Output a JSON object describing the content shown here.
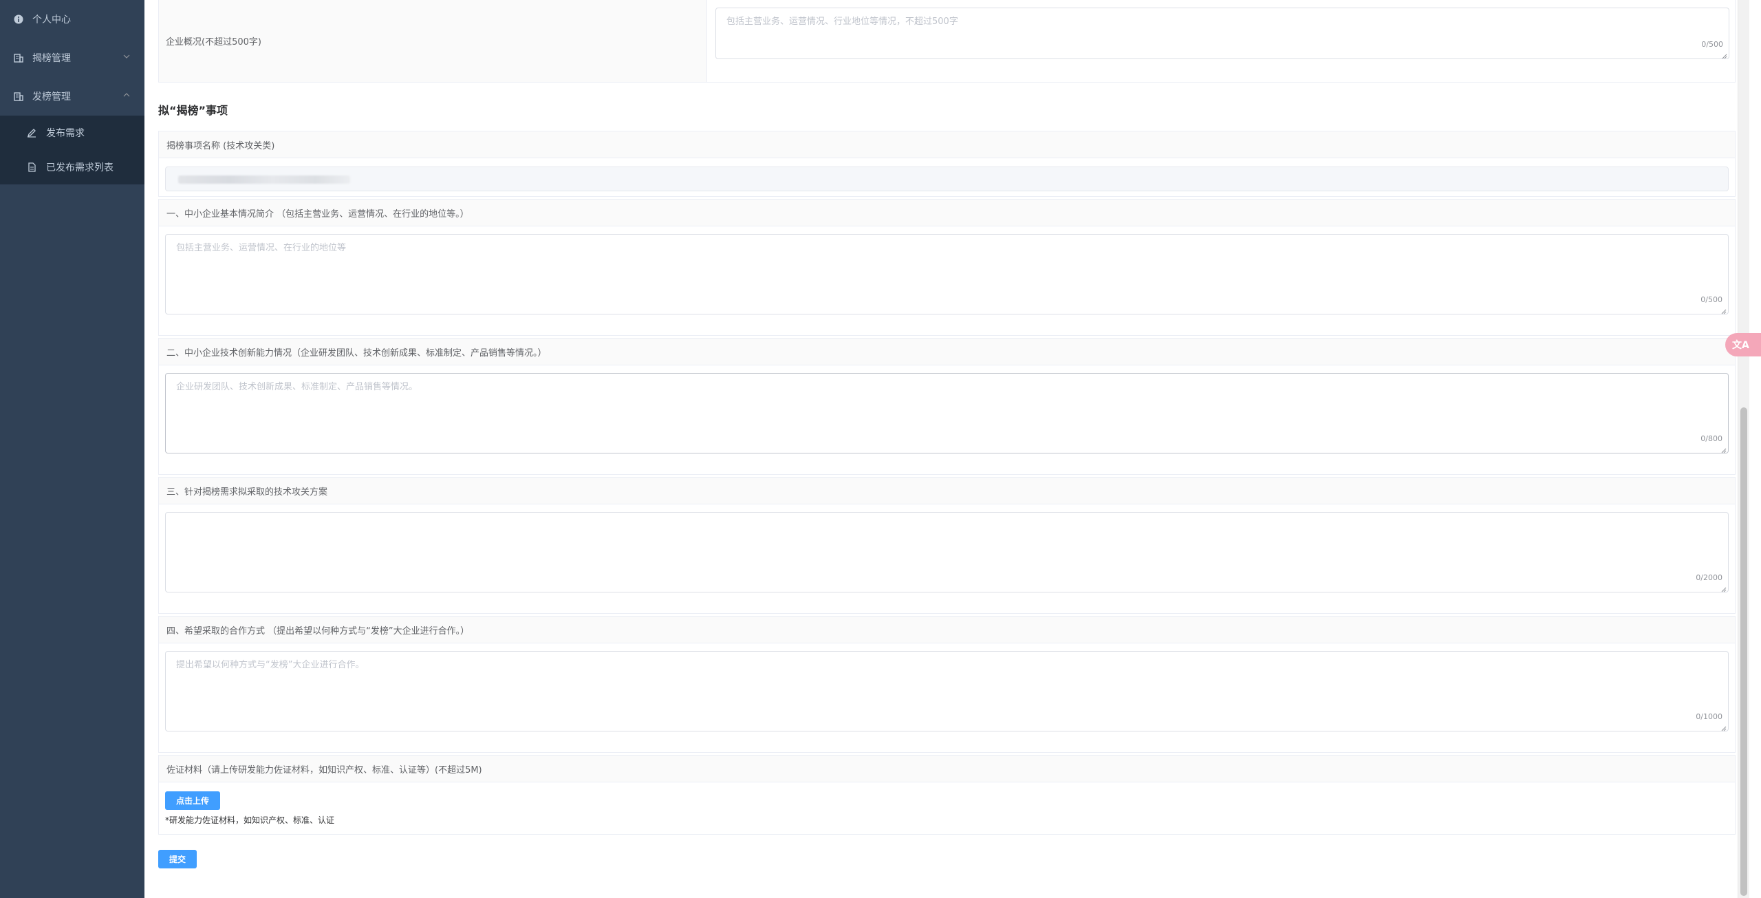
{
  "sidebar": {
    "items": [
      {
        "label": "个人中心",
        "icon": "info-icon"
      },
      {
        "label": "揭榜管理",
        "icon": "building-icon"
      },
      {
        "label": "发榜管理",
        "icon": "building-icon"
      }
    ],
    "sub_items": [
      {
        "label": "发布需求",
        "icon": "edit-icon"
      },
      {
        "label": "已发布需求列表",
        "icon": "document-icon"
      }
    ]
  },
  "form": {
    "company_overview": {
      "label": "企业概况(不超过500字)",
      "placeholder": "包括主营业务、运营情况、行业地位等情况，不超过500字",
      "count": "0/500"
    },
    "section_title": "拟“揭榜”事项",
    "project_name": {
      "label": "揭榜事项名称 (技术攻关类)"
    },
    "field1": {
      "label": "一、中小企业基本情况简介 （包括主营业务、运营情况、在行业的地位等。）",
      "placeholder": "包括主营业务、运营情况、在行业的地位等",
      "count": "0/500"
    },
    "field2": {
      "label": "二、中小企业技术创新能力情况（企业研发团队、技术创新成果、标准制定、产品销售等情况。）",
      "placeholder": "企业研发团队、技术创新成果、标准制定、产品销售等情况。",
      "count": "0/800"
    },
    "field3": {
      "label": "三、针对揭榜需求拟采取的技术攻关方案",
      "placeholder": "",
      "count": "0/2000"
    },
    "field4": {
      "label": "四、希望采取的合作方式 （提出希望以何种方式与“发榜”大企业进行合作。）",
      "placeholder": "提出希望以何种方式与“发榜”大企业进行合作。",
      "count": "0/1000"
    },
    "evidence": {
      "label": "佐证材料（请上传研发能力佐证材料，如知识产权、标准、认证等）(不超过5M)",
      "upload_button": "点击上传",
      "hint": "*研发能力佐证材料，如知识产权、标准、认证"
    },
    "submit_button": "提交"
  },
  "float_button": {
    "label": "文A",
    "icon": "translate-icon"
  },
  "colors": {
    "sidebar_bg": "#304156",
    "submenu_bg": "#1f2d3d",
    "primary": "#409eff"
  }
}
